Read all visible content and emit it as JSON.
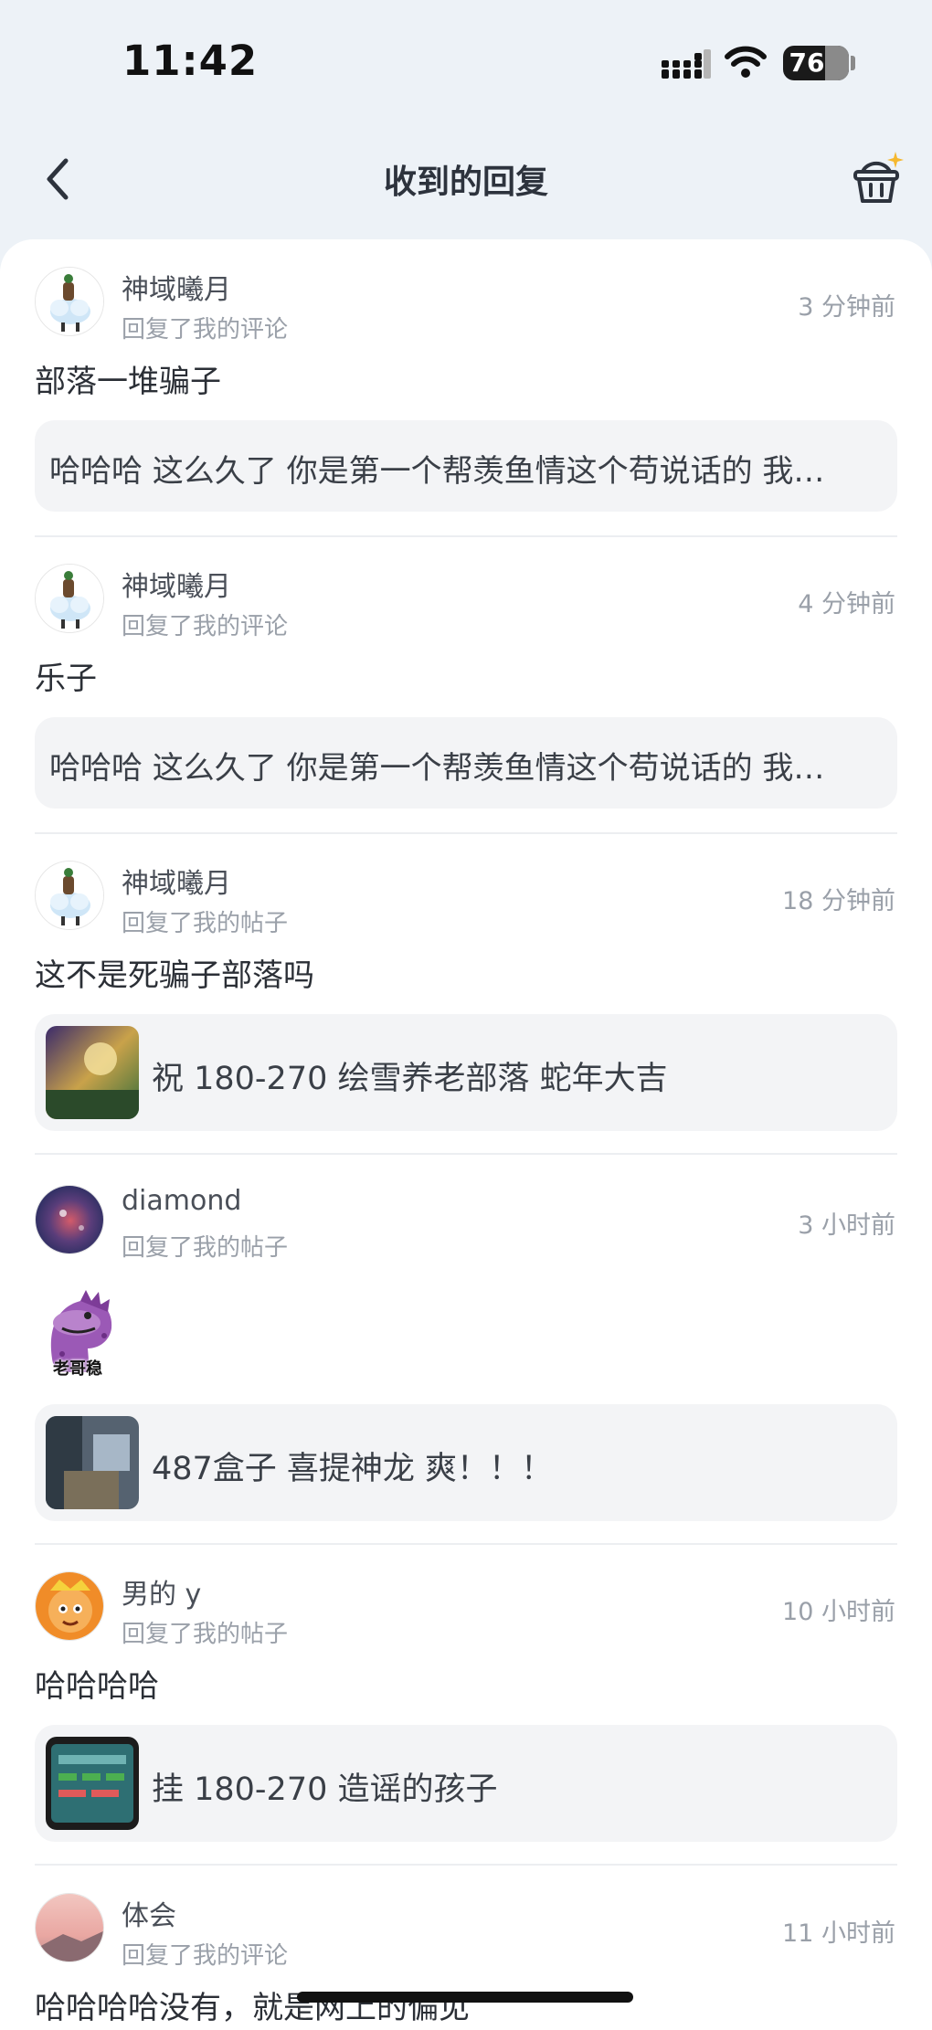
{
  "status_bar": {
    "time": "11:42",
    "battery": "76"
  },
  "nav": {
    "title": "收到的回复"
  },
  "replies": [
    {
      "name": "神域曦月",
      "action": "回复了我的评论",
      "time": "3 分钟前",
      "content": "部落一堆骗子",
      "quote": "哈哈哈 这么久了 你是第一个帮羡鱼情这个苟说话的 我…"
    },
    {
      "name": "神域曦月",
      "action": "回复了我的评论",
      "time": "4 分钟前",
      "content": "乐子",
      "quote": "哈哈哈 这么久了 你是第一个帮羡鱼情这个苟说话的 我…"
    },
    {
      "name": "神域曦月",
      "action": "回复了我的帖子",
      "time": "18 分钟前",
      "content": "这不是死骗子部落吗",
      "quote": "祝 180-270 绘雪养老部落 蛇年大吉"
    },
    {
      "name": "diamond",
      "action": "回复了我的帖子",
      "time": "3 小时前",
      "sticker_text": "老哥稳",
      "quote": "487盒子 喜提神龙 爽！！！"
    },
    {
      "name": "男的 y",
      "action": "回复了我的帖子",
      "time": "10 小时前",
      "content": "哈哈哈哈",
      "quote": "挂 180-270 造谣的孩子"
    },
    {
      "name": "体会",
      "action": "回复了我的评论",
      "time": "11 小时前",
      "content": "哈哈哈哈没有，就是网上的偏见"
    }
  ]
}
